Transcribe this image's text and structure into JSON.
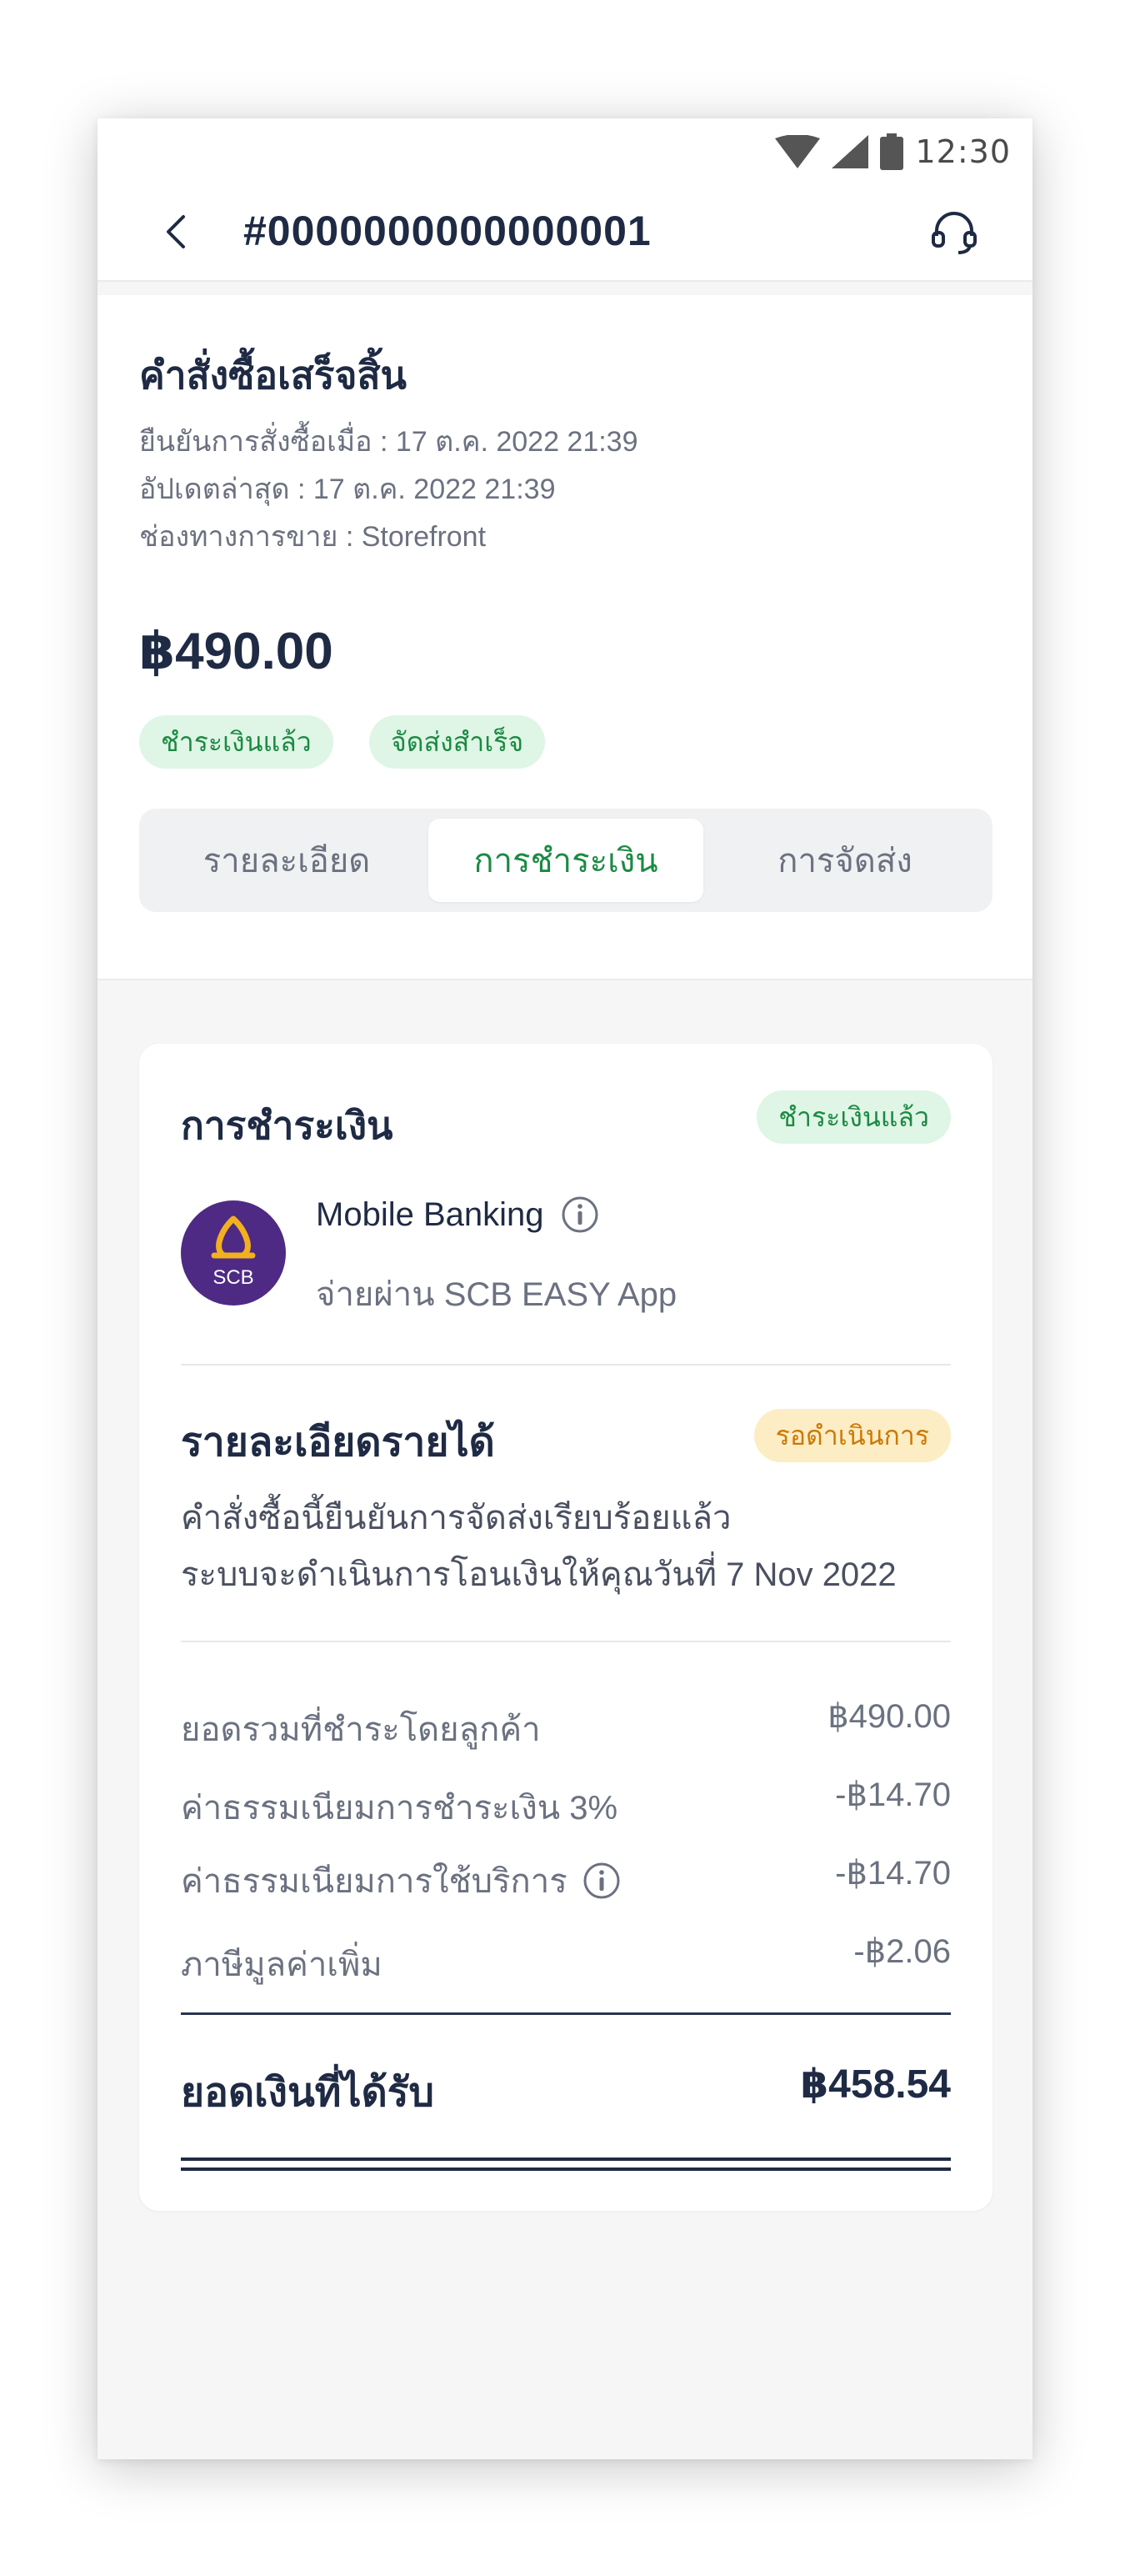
{
  "status_bar": {
    "time": "12:30"
  },
  "header": {
    "order_number": "#0000000000000001"
  },
  "summary": {
    "status_title": "คำสั่งซื้อเสร็จสิ้น",
    "confirmed_at": "ยืนยันการสั่งซื้อเมื่อ : 17 ต.ค. 2022 21:39",
    "updated_at": "อัปเดตล่าสุด : 17 ต.ค. 2022 21:39",
    "channel": "ช่องทางการขาย : Storefront",
    "total": "฿490.00",
    "chips": [
      "ชำระเงินแล้ว",
      "จัดส่งสำเร็จ"
    ]
  },
  "tabs": [
    {
      "label": "รายละเอียด",
      "active": false
    },
    {
      "label": "การชำระเงิน",
      "active": true
    },
    {
      "label": "การจัดส่ง",
      "active": false
    }
  ],
  "payment": {
    "title": "การชำระเงิน",
    "status_badge": "ชำระเงินแล้ว",
    "method": "Mobile Banking",
    "method_detail": "จ่ายผ่าน SCB EASY App",
    "bank_logo_text": "SCB"
  },
  "income": {
    "title": "รายละเอียดรายได้",
    "status_badge": "รอดำเนินการ",
    "desc_line1": "คำสั่งซื้อนี้ยืนยันการจัดส่งเรียบร้อยแล้ว",
    "desc_line2": "ระบบจะดำเนินการโอนเงินให้คุณวันที่ 7 Nov 2022"
  },
  "breakdown": [
    {
      "label": "ยอดรวมที่ชำระโดยลูกค้า",
      "value": "฿490.00",
      "info": false
    },
    {
      "label": "ค่าธรรมเนียมการชำระเงิน 3%",
      "value": "-฿14.70",
      "info": false
    },
    {
      "label": "ค่าธรรมเนียมการใช้บริการ",
      "value": "-฿14.70",
      "info": true
    },
    {
      "label": "ภาษีมูลค่าเพิ่ม",
      "value": "-฿2.06",
      "info": false
    }
  ],
  "received": {
    "label": "ยอดเงินที่ได้รับ",
    "value": "฿458.54"
  },
  "colors": {
    "accent_green": "#1b8a43",
    "chip_green_bg": "#dff5e5",
    "pending_amber": "#c97a08",
    "pending_amber_bg": "#fdedc4",
    "scb_purple": "#4e2a84",
    "scb_gold": "#f2b01e"
  }
}
